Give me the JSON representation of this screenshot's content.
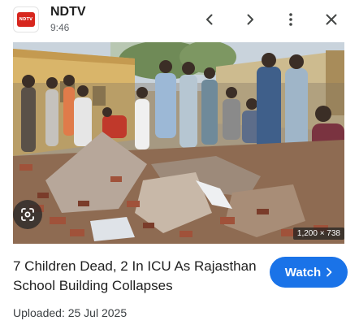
{
  "header": {
    "logo_text": "NDTV",
    "source": "NDTV",
    "time": "9:46"
  },
  "icons": {
    "back": "chevron-left-icon",
    "forward": "chevron-right-icon",
    "more": "more-vert-icon",
    "close": "close-icon",
    "lens": "google-lens-icon"
  },
  "image": {
    "dimensions": "1,200 × 738"
  },
  "article": {
    "headline": "7 Children Dead, 2 In ICU As Rajasthan School Building Collapses",
    "watch_label": "Watch",
    "uploaded": "Uploaded: 25 Jul 2025"
  },
  "colors": {
    "accent": "#1a73e8",
    "logo_red": "#d7261e"
  }
}
